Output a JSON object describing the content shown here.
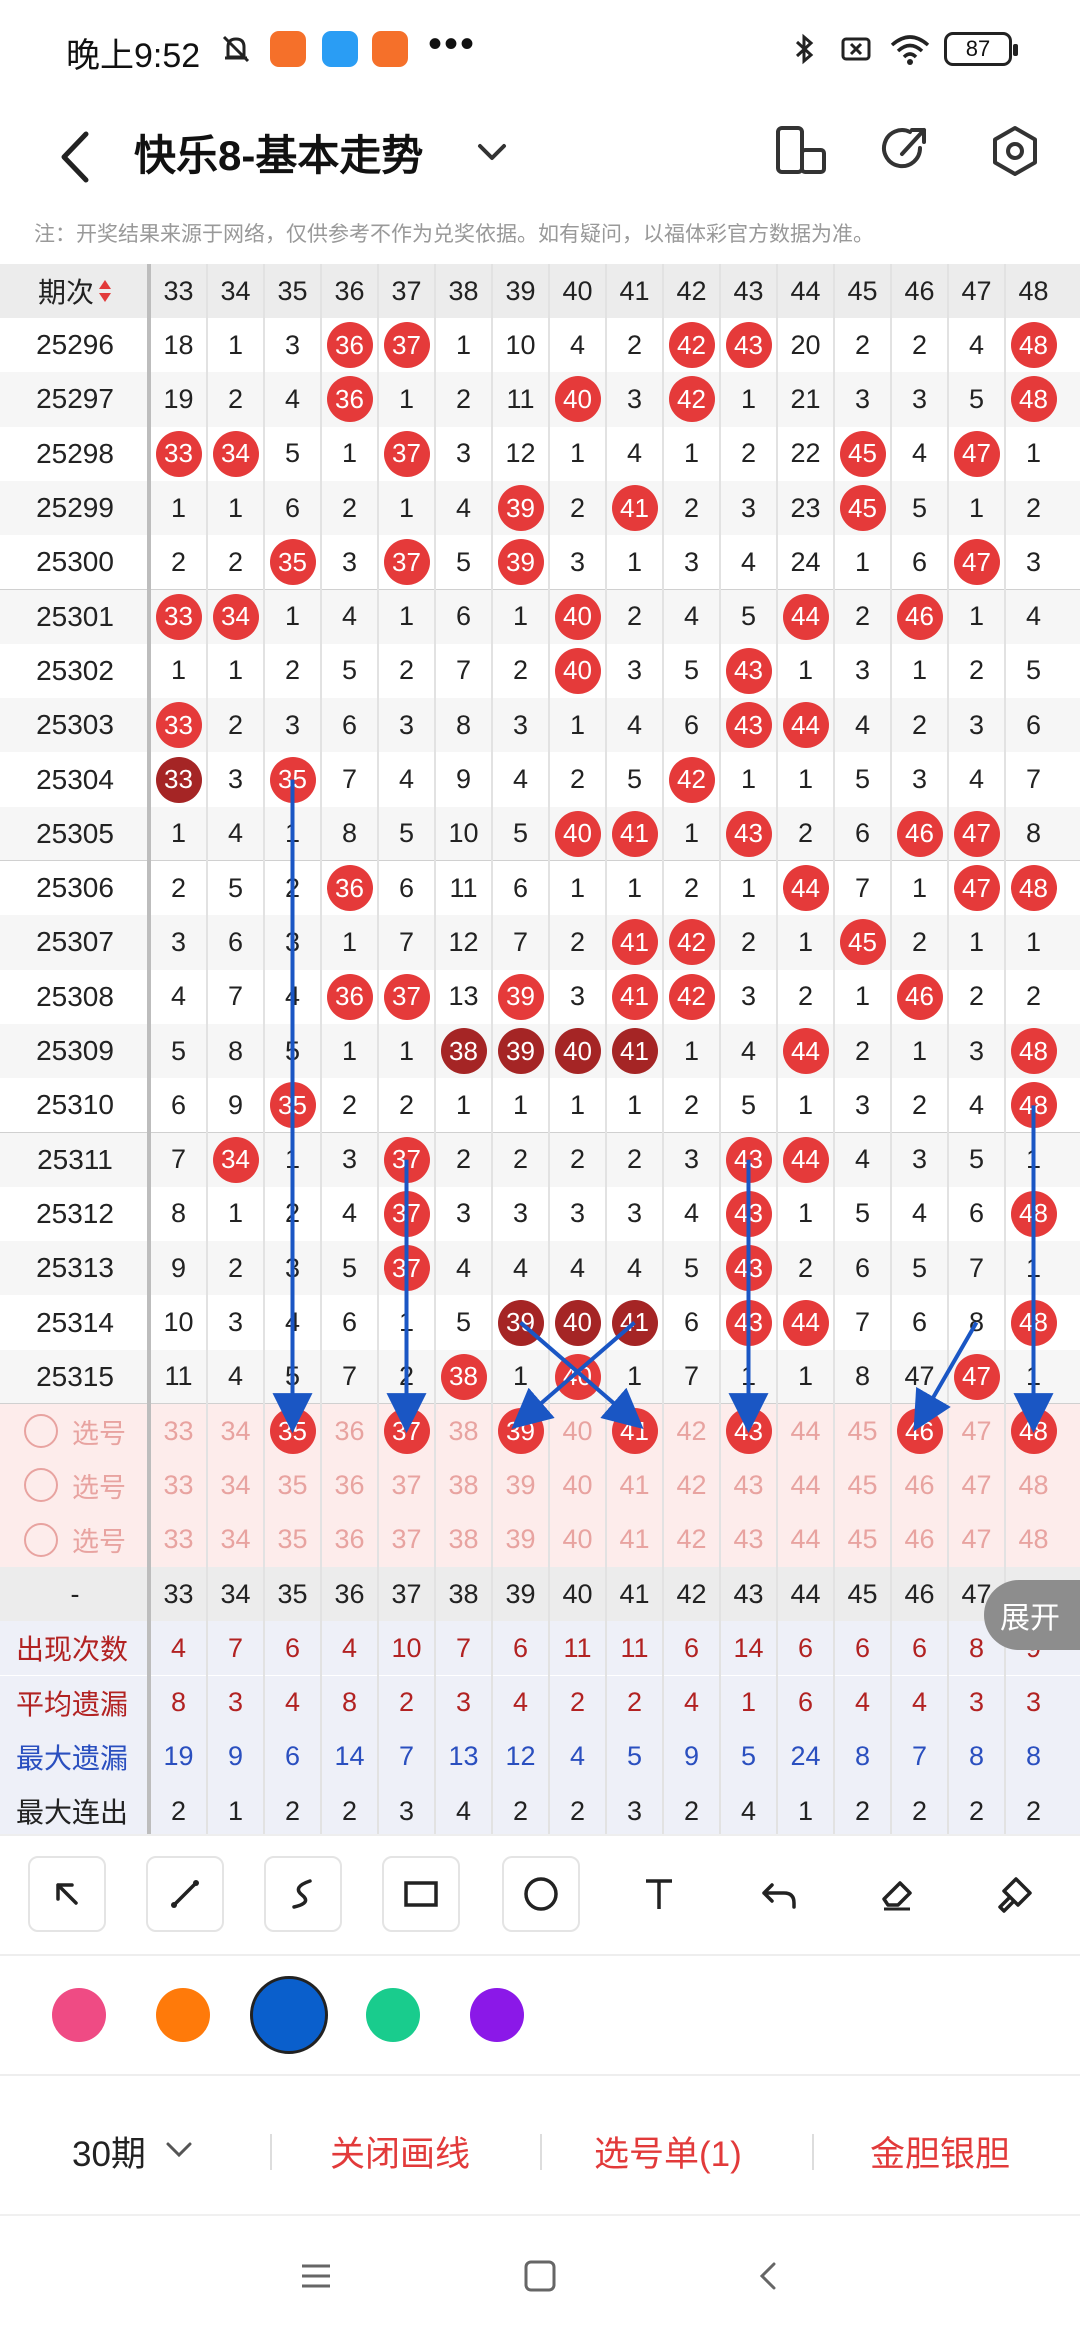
{
  "status": {
    "time": "晚上9:52",
    "battery": "87",
    "colors": {
      "app1": "#f5702a",
      "app2": "#2a9df4",
      "app3": "#f5702a"
    }
  },
  "header": {
    "title": "快乐8-基本走势",
    "icons": [
      "back-icon",
      "chevron-down-icon",
      "phone-rotate-icon",
      "share-icon",
      "settings-icon"
    ]
  },
  "notice": "注：开奖结果来源于网络，仅供参考不作为兑奖依据。如有疑问，以福体彩官方数据为准。",
  "table": {
    "period_header": "期次",
    "columns": [
      "33",
      "34",
      "35",
      "36",
      "37",
      "38",
      "39",
      "40",
      "41",
      "42",
      "43",
      "44",
      "45",
      "46",
      "47",
      "48"
    ],
    "rows": [
      {
        "period": "25296",
        "cells": [
          "18",
          "1",
          "3",
          "36",
          "37",
          "1",
          "10",
          "4",
          "2",
          "42",
          "43",
          "20",
          "2",
          "2",
          "4",
          "48"
        ]
      },
      {
        "period": "25297",
        "cells": [
          "19",
          "2",
          "4",
          "36",
          "1",
          "2",
          "11",
          "40",
          "3",
          "42",
          "1",
          "21",
          "3",
          "3",
          "5",
          "48"
        ]
      },
      {
        "period": "25298",
        "cells": [
          "33",
          "34",
          "5",
          "1",
          "37",
          "3",
          "12",
          "1",
          "4",
          "1",
          "2",
          "22",
          "45",
          "4",
          "47",
          "1"
        ]
      },
      {
        "period": "25299",
        "cells": [
          "1",
          "1",
          "6",
          "2",
          "1",
          "4",
          "39",
          "2",
          "41",
          "2",
          "3",
          "23",
          "45",
          "5",
          "1",
          "2"
        ]
      },
      {
        "period": "25300",
        "cells": [
          "2",
          "2",
          "35",
          "3",
          "37",
          "5",
          "39",
          "3",
          "1",
          "3",
          "4",
          "24",
          "1",
          "6",
          "47",
          "3"
        ]
      },
      {
        "period": "25301",
        "cells": [
          "33",
          "34",
          "1",
          "4",
          "1",
          "6",
          "1",
          "40",
          "2",
          "4",
          "5",
          "44",
          "2",
          "46",
          "1",
          "4"
        ]
      },
      {
        "period": "25302",
        "cells": [
          "1",
          "1",
          "2",
          "5",
          "2",
          "7",
          "2",
          "40",
          "3",
          "5",
          "43",
          "1",
          "3",
          "1",
          "2",
          "5"
        ]
      },
      {
        "period": "25303",
        "cells": [
          "33",
          "2",
          "3",
          "6",
          "3",
          "8",
          "3",
          "1",
          "4",
          "6",
          "43",
          "44",
          "4",
          "2",
          "3",
          "6"
        ]
      },
      {
        "period": "25304",
        "cells": [
          "33",
          "3",
          "35",
          "7",
          "4",
          "9",
          "4",
          "2",
          "5",
          "42",
          "1",
          "1",
          "5",
          "3",
          "4",
          "7"
        ]
      },
      {
        "period": "25305",
        "cells": [
          "1",
          "4",
          "1",
          "8",
          "5",
          "10",
          "5",
          "40",
          "41",
          "1",
          "43",
          "2",
          "6",
          "46",
          "47",
          "8"
        ]
      },
      {
        "period": "25306",
        "cells": [
          "2",
          "5",
          "2",
          "36",
          "6",
          "11",
          "6",
          "1",
          "1",
          "2",
          "1",
          "44",
          "7",
          "1",
          "47",
          "48"
        ]
      },
      {
        "period": "25307",
        "cells": [
          "3",
          "6",
          "3",
          "1",
          "7",
          "12",
          "7",
          "2",
          "41",
          "42",
          "2",
          "1",
          "45",
          "2",
          "1",
          "1"
        ]
      },
      {
        "period": "25308",
        "cells": [
          "4",
          "7",
          "4",
          "36",
          "37",
          "13",
          "39",
          "3",
          "41",
          "42",
          "3",
          "2",
          "1",
          "46",
          "2",
          "2"
        ]
      },
      {
        "period": "25309",
        "cells": [
          "5",
          "8",
          "5",
          "1",
          "1",
          "38",
          "39",
          "40",
          "41",
          "1",
          "4",
          "44",
          "2",
          "1",
          "3",
          "48"
        ]
      },
      {
        "period": "25310",
        "cells": [
          "6",
          "9",
          "35",
          "2",
          "2",
          "1",
          "1",
          "1",
          "1",
          "2",
          "5",
          "1",
          "3",
          "2",
          "4",
          "48"
        ]
      },
      {
        "period": "25311",
        "cells": [
          "7",
          "34",
          "1",
          "3",
          "37",
          "2",
          "2",
          "2",
          "2",
          "3",
          "43",
          "44",
          "4",
          "3",
          "5",
          "1"
        ]
      },
      {
        "period": "25312",
        "cells": [
          "8",
          "1",
          "2",
          "4",
          "37",
          "3",
          "3",
          "3",
          "3",
          "4",
          "43",
          "1",
          "5",
          "4",
          "6",
          "48"
        ]
      },
      {
        "period": "25313",
        "cells": [
          "9",
          "2",
          "3",
          "5",
          "37",
          "4",
          "4",
          "4",
          "4",
          "5",
          "43",
          "2",
          "6",
          "5",
          "7",
          "1"
        ]
      },
      {
        "period": "25314",
        "cells": [
          "10",
          "3",
          "4",
          "6",
          "1",
          "5",
          "39",
          "40",
          "41",
          "6",
          "43",
          "44",
          "7",
          "6",
          "8",
          "48"
        ]
      },
      {
        "period": "25315",
        "cells": [
          "11",
          "4",
          "5",
          "7",
          "2",
          "38",
          "1",
          "40",
          "1",
          "7",
          "1",
          "1",
          "8",
          "47",
          "47",
          "1"
        ]
      }
    ],
    "pick_rows": [
      {
        "label": "选号",
        "selected": [
          "35",
          "37",
          "39",
          "41",
          "43",
          "46",
          "48"
        ]
      },
      {
        "label": "选号",
        "selected": []
      },
      {
        "label": "选号",
        "selected": []
      }
    ],
    "footer_label": "-",
    "stats": [
      {
        "label": "出现次数",
        "color": "#b22222",
        "values": [
          "4",
          "7",
          "6",
          "4",
          "10",
          "7",
          "6",
          "11",
          "11",
          "6",
          "14",
          "6",
          "6",
          "6",
          "8",
          "9"
        ]
      },
      {
        "label": "平均遗漏",
        "color": "#b22222",
        "values": [
          "8",
          "3",
          "4",
          "8",
          "2",
          "3",
          "4",
          "2",
          "2",
          "4",
          "1",
          "6",
          "4",
          "4",
          "3",
          "3"
        ]
      },
      {
        "label": "最大遗漏",
        "color": "#2a4fbf",
        "values": [
          "19",
          "9",
          "6",
          "14",
          "7",
          "13",
          "12",
          "4",
          "5",
          "9",
          "5",
          "24",
          "8",
          "7",
          "8",
          "8"
        ]
      },
      {
        "label": "最大连出",
        "color": "#222222",
        "values": [
          "2",
          "1",
          "2",
          "2",
          "3",
          "4",
          "2",
          "2",
          "3",
          "2",
          "4",
          "1",
          "2",
          "2",
          "2",
          "2"
        ]
      }
    ],
    "expand": "展开"
  },
  "tools": [
    "arrow-tool-icon",
    "line-tool-icon",
    "curve-tool-icon",
    "rectangle-tool-icon",
    "circle-tool-icon",
    "text-tool-icon",
    "undo-icon",
    "eraser-icon",
    "clear-brush-icon"
  ],
  "palette": [
    "#ef4b84",
    "#ff7a0a",
    "#0a5fcc",
    "#19cc8d",
    "#8b18e8"
  ],
  "bottom": {
    "period": "30期",
    "close_draw": "关闭画线",
    "pick_list": "选号单(1)",
    "golden": "金胆银胆"
  }
}
